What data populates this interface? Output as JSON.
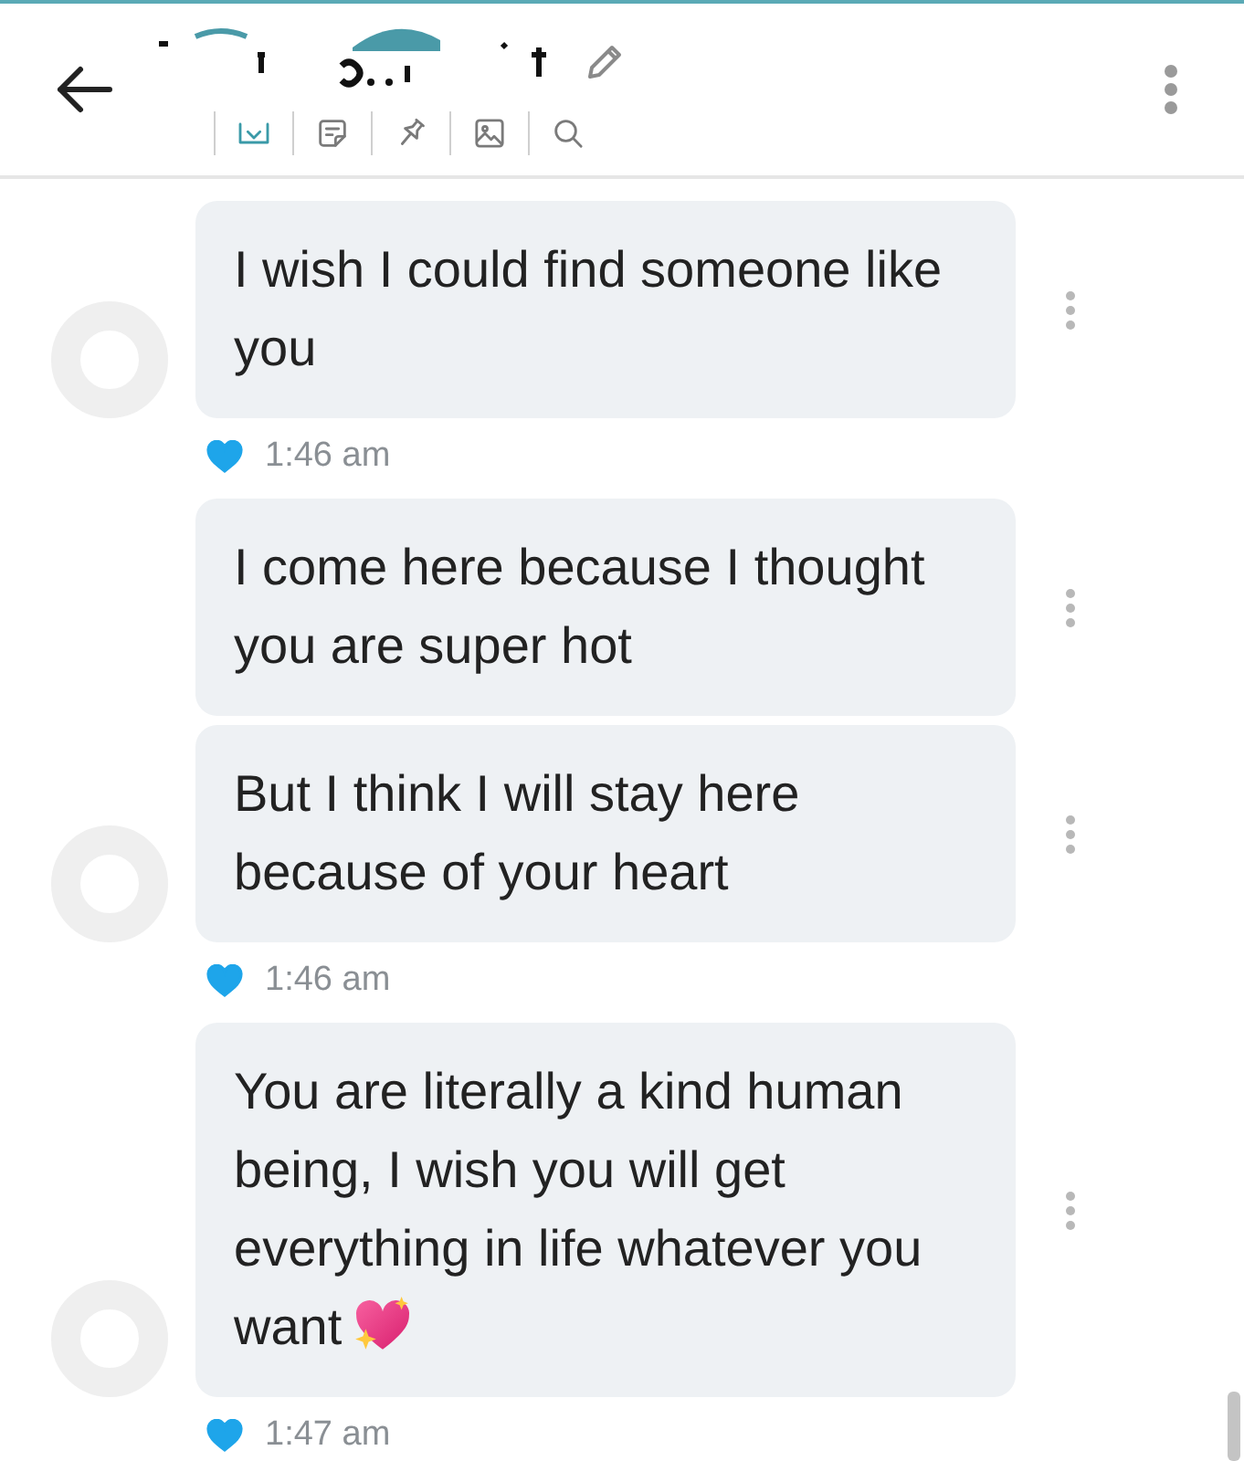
{
  "header": {
    "tools": [
      {
        "kind": "tray",
        "selected": true
      },
      {
        "kind": "note",
        "selected": false
      },
      {
        "kind": "pin",
        "selected": false
      },
      {
        "kind": "image",
        "selected": false
      },
      {
        "kind": "search",
        "selected": false
      }
    ]
  },
  "groups": [
    {
      "messages": [
        {
          "text": "I wish I could find someone like\nyou",
          "emoji": false
        }
      ],
      "liked": true,
      "time": "1:46 am"
    },
    {
      "messages": [
        {
          "text": "I come here because I thought\nyou are super hot",
          "emoji": false
        },
        {
          "text": "But I think I will stay here\nbecause of your heart",
          "emoji": false
        }
      ],
      "liked": true,
      "time": "1:46 am"
    },
    {
      "messages": [
        {
          "text": "You are literally a kind human\nbeing, I wish you will get\neverything in life whatever you\nwant",
          "emoji": true
        }
      ],
      "liked": true,
      "time": "1:47 am"
    }
  ]
}
